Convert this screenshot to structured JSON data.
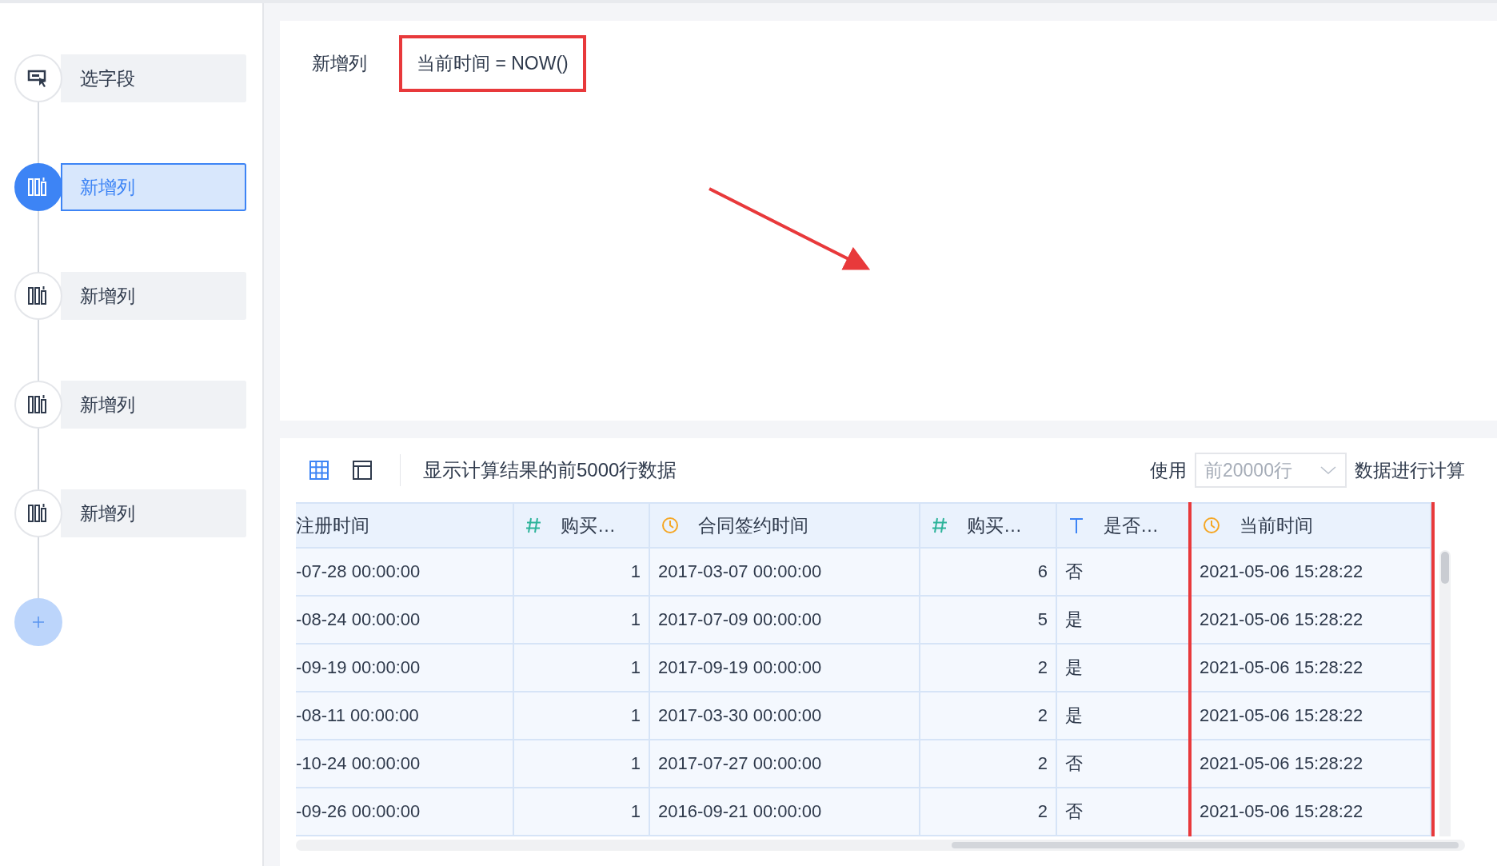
{
  "steps": [
    {
      "kind": "select",
      "label": "选字段",
      "selected": false
    },
    {
      "kind": "add",
      "label": "新增列",
      "selected": true
    },
    {
      "kind": "add",
      "label": "新增列",
      "selected": false
    },
    {
      "kind": "add",
      "label": "新增列",
      "selected": false
    },
    {
      "kind": "add",
      "label": "新增列",
      "selected": false
    }
  ],
  "editor": {
    "label": "新增列",
    "formula": "当前时间 = NOW()",
    "highlighted": true,
    "arrow": true
  },
  "toolbar": {
    "views": [
      {
        "kind": "grid",
        "selected": true
      },
      {
        "kind": "panel",
        "selected": false
      }
    ],
    "info": "显示计算结果的前5000行数据",
    "use_label": "使用",
    "rows_select": "前20000行",
    "suffix": "数据进行计算"
  },
  "table": {
    "columns": [
      {
        "kind": "plain",
        "title": "注册时间",
        "highlighted": false
      },
      {
        "kind": "number",
        "title": "购买…",
        "highlighted": false
      },
      {
        "kind": "date",
        "title": "合同签约时间",
        "highlighted": false
      },
      {
        "kind": "number",
        "title": "购买…",
        "highlighted": false
      },
      {
        "kind": "text",
        "title": "是否…",
        "highlighted": false
      },
      {
        "kind": "date",
        "title": "当前时间",
        "highlighted": true
      }
    ],
    "rows": [
      [
        "-07-28 00:00:00",
        "1",
        "2017-03-07 00:00:00",
        "6",
        "否",
        "2021-05-06 15:28:22"
      ],
      [
        "-08-24 00:00:00",
        "1",
        "2017-07-09 00:00:00",
        "5",
        "是",
        "2021-05-06 15:28:22"
      ],
      [
        "-09-19 00:00:00",
        "1",
        "2017-09-19 00:00:00",
        "2",
        "是",
        "2021-05-06 15:28:22"
      ],
      [
        "-08-11 00:00:00",
        "1",
        "2017-03-30 00:00:00",
        "2",
        "是",
        "2021-05-06 15:28:22"
      ],
      [
        "-10-24 00:00:00",
        "1",
        "2017-07-27 00:00:00",
        "2",
        "否",
        "2021-05-06 15:28:22"
      ],
      [
        "-09-26 00:00:00",
        "1",
        "2016-09-21 00:00:00",
        "2",
        "否",
        "2021-05-06 15:28:22"
      ]
    ]
  }
}
